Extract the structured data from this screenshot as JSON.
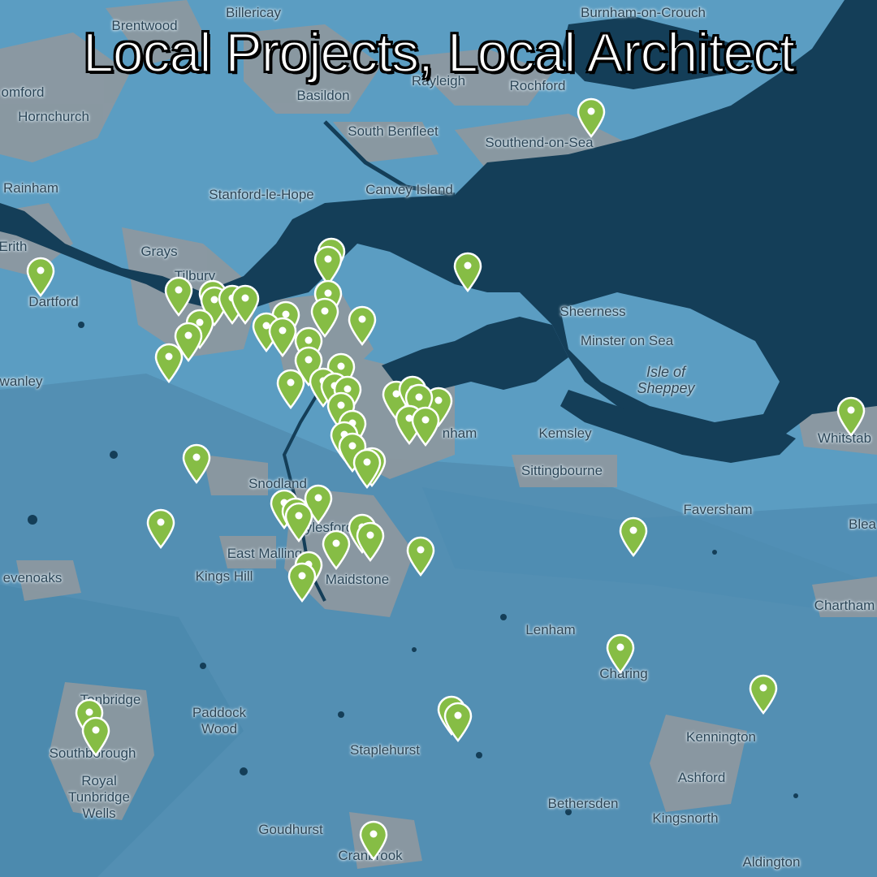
{
  "title": "Local Projects, Local Architect",
  "colors": {
    "land": "#5b9dc2",
    "land_dark": "#4d8cb2",
    "urban": "#8e979c",
    "water": "#143e58",
    "pin_fill": "#86bd45",
    "pin_stroke": "#ffffff"
  },
  "places": [
    {
      "name": "Brentwood",
      "id": "brentwood"
    },
    {
      "name": "Billericay",
      "id": "billericay"
    },
    {
      "name": "Burnham-on-Crouch",
      "id": "burnham-on-crouch"
    },
    {
      "name": "Romford",
      "id": "romford",
      "display": "omford"
    },
    {
      "name": "Hornchurch",
      "id": "hornchurch"
    },
    {
      "name": "Basildon",
      "id": "basildon"
    },
    {
      "name": "Rayleigh",
      "id": "rayleigh",
      "display": "Rayleigh"
    },
    {
      "name": "Rochford",
      "id": "rochford"
    },
    {
      "name": "South Benfleet",
      "id": "south-benfleet"
    },
    {
      "name": "Southend-on-Sea",
      "id": "southend"
    },
    {
      "name": "Rainham",
      "id": "rainham"
    },
    {
      "name": "Stanford-le-Hope",
      "id": "stanford"
    },
    {
      "name": "Canvey Island",
      "id": "canvey"
    },
    {
      "name": "Grays",
      "id": "grays"
    },
    {
      "name": "Erith",
      "id": "erith",
      "display": "Erith"
    },
    {
      "name": "Tilbury",
      "id": "tilbury"
    },
    {
      "name": "Dartford",
      "id": "dartford"
    },
    {
      "name": "Sheerness",
      "id": "sheerness"
    },
    {
      "name": "Minster on Sea",
      "id": "minster"
    },
    {
      "name": "Isle of Sheppey",
      "id": "sheppey"
    },
    {
      "name": "Swanley",
      "id": "swanley",
      "display": "wanley"
    },
    {
      "name": "Kemsley",
      "id": "kemsley"
    },
    {
      "name": "Whitstable",
      "id": "whitstable",
      "display": "Whitstab"
    },
    {
      "name": "Gillingham",
      "id": "gillingham",
      "display": "nham"
    },
    {
      "name": "Sittingbourne",
      "id": "sittingbourne"
    },
    {
      "name": "Snodland",
      "id": "snodland"
    },
    {
      "name": "Faversham",
      "id": "faversham"
    },
    {
      "name": "Blean",
      "id": "blean",
      "display": "Blea"
    },
    {
      "name": "Aylesford",
      "id": "aylesford",
      "display": "Aylesford"
    },
    {
      "name": "East Malling",
      "id": "east-malling"
    },
    {
      "name": "Sevenoaks",
      "id": "sevenoaks",
      "display": "evenoaks"
    },
    {
      "name": "Kings Hill",
      "id": "kings-hill"
    },
    {
      "name": "Maidstone",
      "id": "maidstone"
    },
    {
      "name": "Chartham",
      "id": "chartham"
    },
    {
      "name": "Lenham",
      "id": "lenham"
    },
    {
      "name": "Charing",
      "id": "charing"
    },
    {
      "name": "Tonbridge",
      "id": "tonbridge"
    },
    {
      "name": "Paddock Wood",
      "id": "paddock-wood"
    },
    {
      "name": "Southborough",
      "id": "southborough"
    },
    {
      "name": "Staplehurst",
      "id": "staplehurst"
    },
    {
      "name": "Kennington",
      "id": "kennington"
    },
    {
      "name": "Royal Tunbridge Wells",
      "id": "tunbridge-wells"
    },
    {
      "name": "Ashford",
      "id": "ashford"
    },
    {
      "name": "Bethersden",
      "id": "bethersden"
    },
    {
      "name": "Kingsnorth",
      "id": "kingsnorth"
    },
    {
      "name": "Goudhurst",
      "id": "goudhurst"
    },
    {
      "name": "Cranbrook",
      "id": "cranbrook"
    },
    {
      "name": "Aldington",
      "id": "aldington"
    }
  ]
}
